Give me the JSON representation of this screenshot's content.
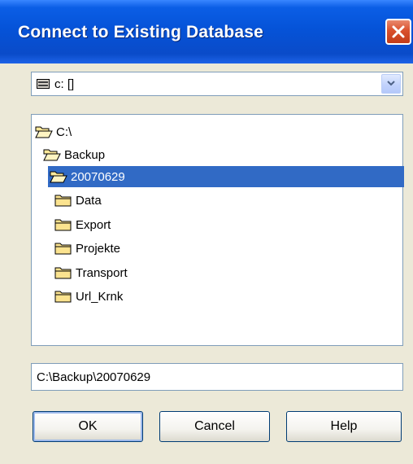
{
  "window": {
    "title": "Connect to Existing Database"
  },
  "drive": {
    "selected": "c: []"
  },
  "tree": {
    "items": [
      {
        "label": "C:\\",
        "icon": "open-folder-icon",
        "selected": false
      },
      {
        "label": "Backup",
        "icon": "open-folder-icon",
        "selected": false
      },
      {
        "label": "20070629",
        "icon": "open-folder-icon",
        "selected": true
      },
      {
        "label": "Data",
        "icon": "folder-icon",
        "selected": false
      },
      {
        "label": "Export",
        "icon": "folder-icon",
        "selected": false
      },
      {
        "label": "Projekte",
        "icon": "folder-icon",
        "selected": false
      },
      {
        "label": "Transport",
        "icon": "folder-icon",
        "selected": false
      },
      {
        "label": "Url_Krnk",
        "icon": "folder-icon",
        "selected": false
      }
    ]
  },
  "path": {
    "value": "C:\\Backup\\20070629"
  },
  "buttons": {
    "ok": "OK",
    "cancel": "Cancel",
    "help": "Help"
  },
  "colors": {
    "title_bar": "#0553d8",
    "selection": "#316ac5",
    "dialog_bg": "#ece9d8",
    "close_button": "#d9502c"
  }
}
